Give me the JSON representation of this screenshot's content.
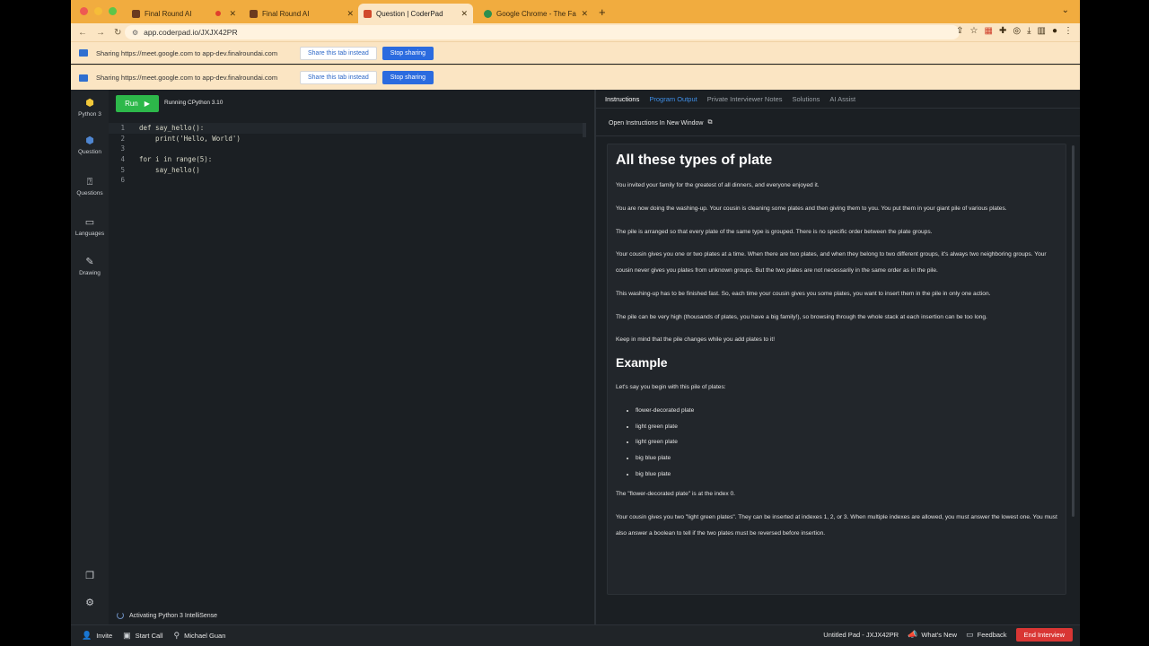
{
  "tabs": [
    {
      "title": "Final Round AI",
      "fav_color": "#6b3a1f",
      "recording": true
    },
    {
      "title": "Final Round AI",
      "fav_color": "#6b3a1f",
      "recording": false
    },
    {
      "title": "Question | CoderPad",
      "fav_color": "#d14a2b",
      "recording": false
    },
    {
      "title": "Google Chrome - The Fast & Se",
      "fav_color": "#2d8f4e",
      "recording": false
    }
  ],
  "toolbar": {
    "url": "app.coderpad.io/JXJX42PR"
  },
  "sharing": [
    {
      "text": "Sharing https://meet.google.com to app-dev.finalroundai.com",
      "share_label": "Share this tab instead",
      "stop_label": "Stop sharing"
    },
    {
      "text": "Sharing https://meet.google.com to app-dev.finalroundai.com",
      "share_label": "Share this tab instead",
      "stop_label": "Stop sharing"
    }
  ],
  "rail": [
    {
      "label": "Python 3",
      "icon": "python-icon"
    },
    {
      "label": "Question",
      "icon": "question-icon"
    },
    {
      "label": "Questions",
      "icon": "questions-icon"
    },
    {
      "label": "Languages",
      "icon": "languages-icon"
    },
    {
      "label": "Drawing",
      "icon": "pencil-icon"
    }
  ],
  "editor": {
    "run_label": "Run",
    "runtime": "Running CPython 3.10",
    "lines": [
      {
        "n": "1",
        "text": "def say_hello():"
      },
      {
        "n": "2",
        "text": "    print('Hello, World')"
      },
      {
        "n": "3",
        "text": ""
      },
      {
        "n": "4",
        "text": "for i in range(5):"
      },
      {
        "n": "5",
        "text": "    say_hello()"
      },
      {
        "n": "6",
        "text": ""
      }
    ],
    "status": "Activating Python 3 IntelliSense"
  },
  "right_tabs": [
    "Instructions",
    "Program Output",
    "Private Interviewer Notes",
    "Solutions",
    "AI Assist"
  ],
  "open_instructions": "Open Instructions In New Window",
  "instructions": {
    "title": "All these types of plate",
    "paras": [
      "You invited your family for the greatest of all dinners, and everyone enjoyed it.",
      "You are now doing the washing-up. Your cousin is cleaning some plates and then giving them to you. You put them in your giant pile of various plates.",
      "The pile is arranged so that every plate of the same type is grouped. There is no specific order between the plate groups.",
      "Your cousin gives you one or two plates at a time. When there are two plates, and when they belong to two different groups, it's always two neighboring groups. Your cousin never gives you plates from unknown groups. But the two plates are not necessarily in the same order as in the pile.",
      "This washing-up has to be finished fast. So, each time your cousin gives you some plates, you want to insert them in the pile in only one action.",
      "The pile can be very high (thousands of plates, you have a big family!), so browsing through the whole stack at each insertion can be too long.",
      "Keep in mind that the pile changes while you add plates to it!"
    ],
    "example_heading": "Example",
    "example_intro": "Let's say you begin with this pile of plates:",
    "plates": [
      "flower-decorated plate",
      "light green plate",
      "light green plate",
      "big blue plate",
      "big blue plate"
    ],
    "after": [
      "The \"flower-decorated plate\" is at the index 0.",
      "Your cousin gives you two \"light green plates\". They can be inserted at indexes 1, 2, or 3. When multiple indexes are allowed, you must answer the lowest one. You must also answer a boolean to tell if the two plates must be reversed before insertion."
    ]
  },
  "bottom": {
    "invite": "Invite",
    "start_call": "Start Call",
    "user": "Michael Guan",
    "pad_name": "Untitled Pad - JXJX42PR",
    "whats_new": "What's New",
    "feedback": "Feedback",
    "end_interview": "End Interview"
  },
  "colors": {
    "run": "#2db84a",
    "end": "#d93634",
    "stop_sharing": "#2b6bdf",
    "tabstrip": "#f1ac3f"
  }
}
